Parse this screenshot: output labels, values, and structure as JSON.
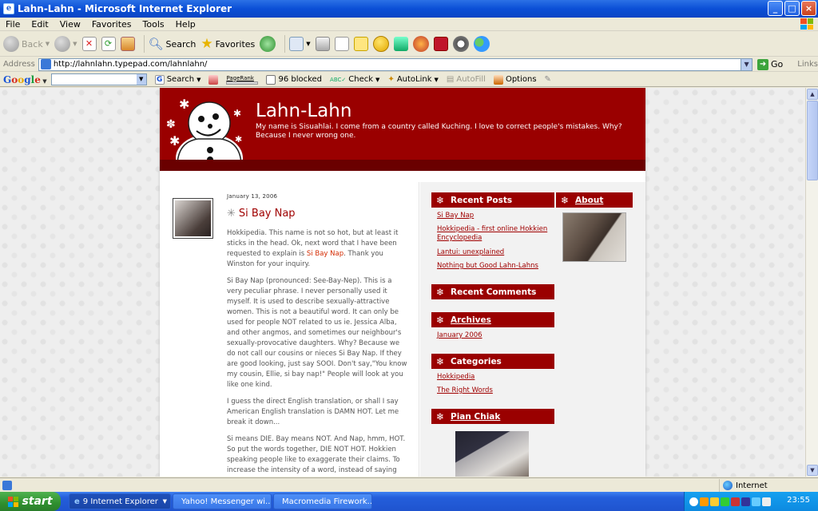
{
  "window": {
    "title": "Lahn-Lahn - Microsoft Internet Explorer",
    "min": "_",
    "max": "□",
    "close": "×"
  },
  "menu": [
    "File",
    "Edit",
    "View",
    "Favorites",
    "Tools",
    "Help"
  ],
  "toolbar": {
    "back": "Back",
    "search": "Search",
    "favorites": "Favorites"
  },
  "address": {
    "label": "Address",
    "url": "http://lahnlahn.typepad.com/lahnlahn/",
    "go": "Go",
    "links": "Links"
  },
  "google": {
    "logo": [
      "G",
      "o",
      "o",
      "g",
      "l",
      "e"
    ],
    "search": "Search",
    "pagerank": "PageRank",
    "blocked": "96 blocked",
    "check": "Check",
    "autolink": "AutoLink",
    "autofill": "AutoFill",
    "options": "Options"
  },
  "blog": {
    "title": "Lahn-Lahn",
    "description": "My name is Sisuahlai. I come from a country called Kuching. I love to correct people's mistakes. Why? Because I never wrong one."
  },
  "post": {
    "date": "January 13, 2006",
    "title": "Si Bay Nap",
    "p1_a": "Hokkipedia. This name is not so hot, but at least it sticks in the head. Ok, next word that I have been requested to explain is ",
    "p1_link": "Si Bay Nap",
    "p1_b": ".  Thank you Winston for your inquiry.",
    "p2": "Si Bay Nap (pronounced: See-Bay-Nep). This is a very peculiar phrase. I never personally used it myself. It is used to describe sexually-attractive women. This is not a beautiful word. It can only be used for people NOT related to us ie. Jessica Alba, and other angmos, and sometimes our neighbour's sexually-provocative daughters. Why? Because we do not call our cousins or nieces Si Bay Nap. If they are good looking, just say SOOI. Don't say,\"You know my cousin, Ellie, si bay nap!\" People will look at you like one kind.",
    "p3": "I guess the direct English translation, or shall I say American English translation is DAMN HOT. Let me break it down...",
    "p4": "Si means DIE. Bay means NOT. And Nap, hmm, HOT. So put the words together, DIE NOT HOT. Hokkien speaking people like to exaggerate their claims. To increase the intensity of a word, instead of saying HOT, HOTTER, and HOTTEST, Hokkien speaking people"
  },
  "sidebar": {
    "recent_posts": {
      "title": "Recent Posts",
      "items": [
        "Si Bay Nap",
        "Hokkipedia - first online Hokkien Encyclopedia",
        "Lantui: unexplained",
        "Nothing but Good Lahn-Lahns"
      ]
    },
    "about": "About",
    "recent_comments": "Recent Comments",
    "archives": {
      "title": "Archives",
      "items": [
        "January 2006"
      ]
    },
    "categories": {
      "title": "Categories",
      "items": [
        "Hokkipedia",
        "The Right Words"
      ]
    },
    "pian_chiak": "Pian Chiak"
  },
  "status": {
    "zone": "Internet"
  },
  "taskbar": {
    "start": "start",
    "tasks": [
      "9 Internet Explorer",
      "Yahoo! Messenger wi...",
      "Macromedia Firework..."
    ],
    "clock": "23:55"
  },
  "colors": {
    "banner": "#9a0000",
    "link": "#a00000",
    "accent": "#d42a00"
  }
}
